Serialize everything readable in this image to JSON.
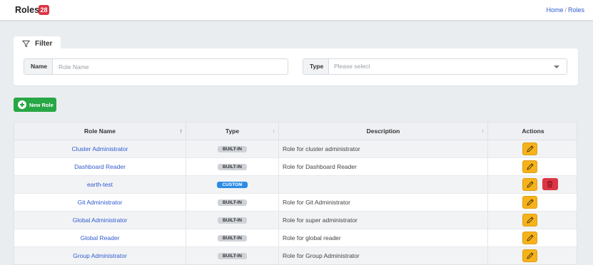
{
  "header": {
    "title": "Roles",
    "count": "28",
    "breadcrumb": [
      {
        "label": "Home"
      },
      {
        "label": "Roles"
      }
    ]
  },
  "filter": {
    "tab_label": "Filter",
    "name_label": "Name",
    "name_placeholder": "Role Name",
    "type_label": "Type",
    "type_placeholder": "Please select"
  },
  "toolbar": {
    "new_role_label": "New Role"
  },
  "table": {
    "columns": [
      "Role Name",
      "Type",
      "Description",
      "Actions"
    ],
    "rows": [
      {
        "name": "Cluster Administrator",
        "type": "BUILT-IN",
        "description": "Role for cluster administrator",
        "deletable": false
      },
      {
        "name": "Dashboard Reader",
        "type": "BUILT-IN",
        "description": "Role for Dashboard Reader",
        "deletable": false
      },
      {
        "name": "earth-test",
        "type": "CUSTOM",
        "description": "",
        "deletable": true
      },
      {
        "name": "Git Administrator",
        "type": "BUILT-IN",
        "description": "Role for Git Administrator",
        "deletable": false
      },
      {
        "name": "Global Administrator",
        "type": "BUILT-IN",
        "description": "Role for super administrator",
        "deletable": false
      },
      {
        "name": "Global Reader",
        "type": "BUILT-IN",
        "description": "Role for global reader",
        "deletable": false
      },
      {
        "name": "Group Administrator",
        "type": "BUILT-IN",
        "description": "Role for Group Administrator",
        "deletable": false
      }
    ]
  },
  "colors": {
    "badge_danger": "#dc3545",
    "primary_link": "#2f5bd0",
    "success": "#28a745",
    "warning": "#f6b21b",
    "custom_badge": "#2b8be6"
  }
}
